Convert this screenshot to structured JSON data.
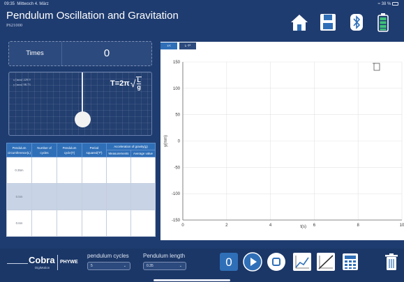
{
  "status_bar": {
    "time": "09:35",
    "date": "Mittwoch 4. März",
    "battery": "38 %"
  },
  "header": {
    "title": "Pendulum Oscillation and Gravitation",
    "subtitle": "P621000"
  },
  "times_panel": {
    "label": "Times",
    "value": "0"
  },
  "pendulum_panel": {
    "x_readout": "x  [mm]   229.9",
    "y_readout": "y  [mm]   98.73",
    "formula_lhs": "T=2π",
    "formula_num": "L",
    "formula_den": "g"
  },
  "table": {
    "headers": {
      "circumference": "Pendulum circumference(L)",
      "cycles": "Number of cycles",
      "pendulum_cycle": "Pendulum cycle(T)",
      "period_squared": "Period squared(T²)",
      "acceleration": "Acceleration of gravity(g)",
      "measurement": "Measurements",
      "average": "Average value"
    },
    "rows": [
      {
        "length": "0.35m",
        "cycles": "",
        "cycle": "",
        "squared": "",
        "measurement": "",
        "average": ""
      },
      {
        "length": "0.5m",
        "cycles": "",
        "cycle": "",
        "squared": "",
        "measurement": "",
        "average": ""
      },
      {
        "length": "0.6m",
        "cycles": "",
        "cycle": "",
        "squared": "",
        "measurement": "",
        "average": ""
      }
    ]
  },
  "graph": {
    "tabs": [
      "x-t",
      "L-T²"
    ],
    "active_tab": 0
  },
  "chart_data": {
    "type": "line",
    "x": [],
    "series": [],
    "xlabel": "t(s)",
    "ylabel": "y(mm)",
    "xlim": [
      0,
      10
    ],
    "ylim": [
      -150,
      150
    ],
    "xticks": [
      0,
      2,
      4,
      6,
      8,
      10
    ],
    "yticks": [
      150,
      100,
      50,
      0,
      -50,
      -100,
      -150
    ],
    "grid": true
  },
  "controls": {
    "cycles_label": "pendulum cycles",
    "cycles_value": "5",
    "length_label": "Pendulum length",
    "length_value": "0.35",
    "counter_value": "0"
  },
  "brand": {
    "cobra": "Cobra",
    "digimotion": "DigiMotion",
    "phywe": "PHYWE"
  },
  "colors": {
    "background": "#1f3c70",
    "accent": "#2f6fb8",
    "panel": "#2c4a7d"
  }
}
